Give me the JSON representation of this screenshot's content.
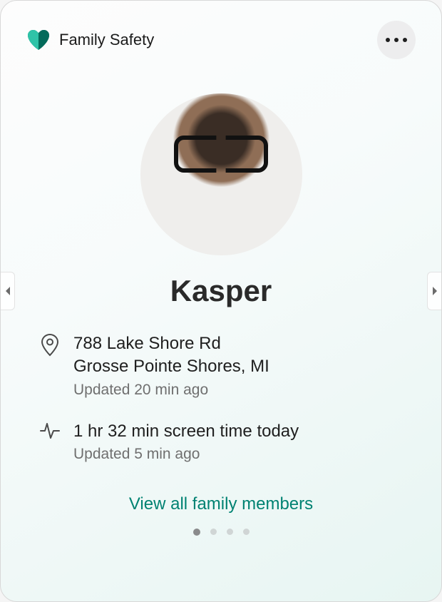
{
  "brand": {
    "title": "Family Safety",
    "icon": "heart-shield-icon"
  },
  "profile": {
    "name": "Kasper",
    "avatar_alt": "Kasper profile photo"
  },
  "location": {
    "line1": "788 Lake Shore Rd",
    "line2": "Grosse Pointe Shores, MI",
    "updated": "Updated 20 min ago"
  },
  "screenTime": {
    "summary": "1 hr 32 min screen time today",
    "updated": "Updated 5 min ago"
  },
  "actions": {
    "view_all": "View all family members"
  },
  "pager": {
    "count": 4,
    "active_index": 0
  },
  "colors": {
    "accent": "#008272",
    "brand_teal_dark": "#036b5b",
    "brand_teal_light": "#2fc3a8"
  }
}
